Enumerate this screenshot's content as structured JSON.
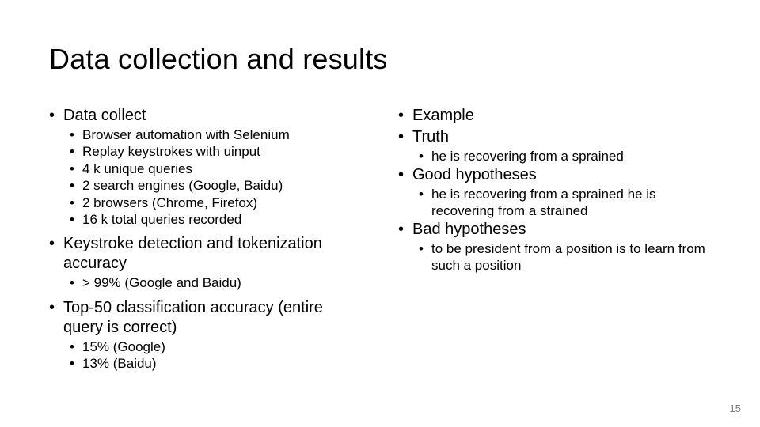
{
  "title": "Data collection and results",
  "left": {
    "sections": [
      {
        "heading": "Data collect",
        "items": [
          "Browser automation with Selenium",
          "Replay keystrokes with uinput",
          "4 k unique queries",
          "2 search engines (Google, Baidu)",
          "2 browsers (Chrome, Firefox)",
          "16 k total queries recorded"
        ]
      },
      {
        "heading": "Keystroke detection and tokenization accuracy",
        "items": [
          " > 99% (Google and Baidu)"
        ]
      },
      {
        "heading": "Top-50 classification accuracy (entire query is correct)",
        "items": [
          "15% (Google)",
          "13% (Baidu)"
        ]
      }
    ]
  },
  "right": {
    "sections": [
      {
        "heading": "Example",
        "items": []
      },
      {
        "heading": "Truth",
        "items": [
          "he is recovering from a sprained"
        ]
      },
      {
        "heading": "Good hypotheses",
        "items": [
          "he is recovering from a sprained he is recovering from a strained"
        ]
      },
      {
        "heading": "Bad hypotheses",
        "items": [
          "to be president from a position is to learn from such a position"
        ]
      }
    ]
  },
  "page_number": "15"
}
